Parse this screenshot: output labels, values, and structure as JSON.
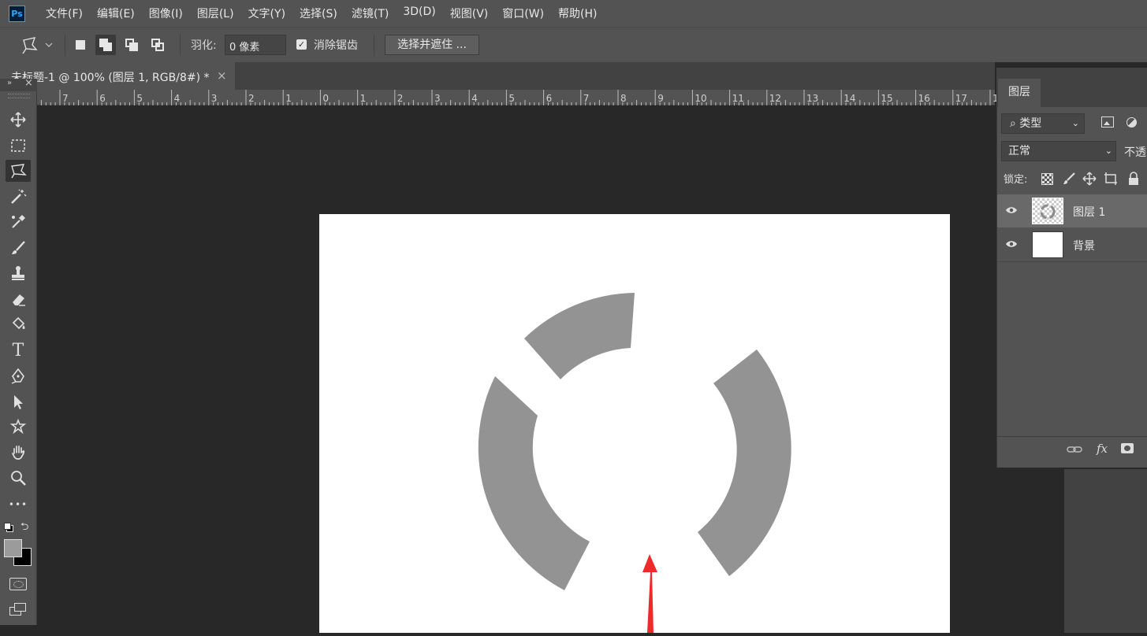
{
  "app": {
    "logo": "Ps",
    "menus": [
      "文件(F)",
      "编辑(E)",
      "图像(I)",
      "图层(L)",
      "文字(Y)",
      "选择(S)",
      "滤镜(T)",
      "3D(D)",
      "视图(V)",
      "窗口(W)",
      "帮助(H)"
    ]
  },
  "options": {
    "feather_label": "羽化:",
    "feather_value": "0 像素",
    "antialias_label": "消除锯齿",
    "antialias_checked": true,
    "select_mask_label": "选择并遮住 ..."
  },
  "document": {
    "tab_title": "未标题-1 @ 100% (图层 1, RGB/8#) *",
    "close": "×"
  },
  "ruler": {
    "labels": [
      "7",
      "6",
      "5",
      "4",
      "3",
      "2",
      "1",
      "0",
      "1",
      "2",
      "3",
      "4",
      "5",
      "6",
      "7",
      "8",
      "9",
      "10",
      "11",
      "12",
      "13",
      "14",
      "15",
      "16",
      "17",
      "1"
    ]
  },
  "tools": [
    {
      "icon": "move-icon"
    },
    {
      "icon": "rect-marquee-icon"
    },
    {
      "icon": "polygonal-lasso-icon",
      "active": true
    },
    {
      "icon": "magic-wand-icon"
    },
    {
      "icon": "eyedropper-icon"
    },
    {
      "icon": "brush-icon"
    },
    {
      "icon": "stamp-icon"
    },
    {
      "icon": "eraser-icon"
    },
    {
      "icon": "paint-bucket-icon"
    },
    {
      "icon": "type-icon",
      "glyph": "T"
    },
    {
      "icon": "pen-icon"
    },
    {
      "icon": "path-selection-icon"
    },
    {
      "icon": "custom-shape-icon"
    },
    {
      "icon": "hand-icon"
    },
    {
      "icon": "zoom-icon"
    },
    {
      "icon": "more-tools-icon",
      "glyph": "•••"
    }
  ],
  "colors": {
    "foreground": "#9b9b9b",
    "background": "#000000",
    "shape_fill": "#939393",
    "arrow": "#ee2b2b"
  },
  "layers_panel": {
    "tab": "图层",
    "kind_filter": "类型",
    "blend_mode": "正常",
    "opacity_label": "不透",
    "lock_label": "锁定:",
    "layers": [
      {
        "name": "图层 1",
        "selected": true,
        "thumb": "transparent"
      },
      {
        "name": "背景",
        "selected": false,
        "thumb": "white"
      }
    ],
    "footer_fx": "fx"
  }
}
